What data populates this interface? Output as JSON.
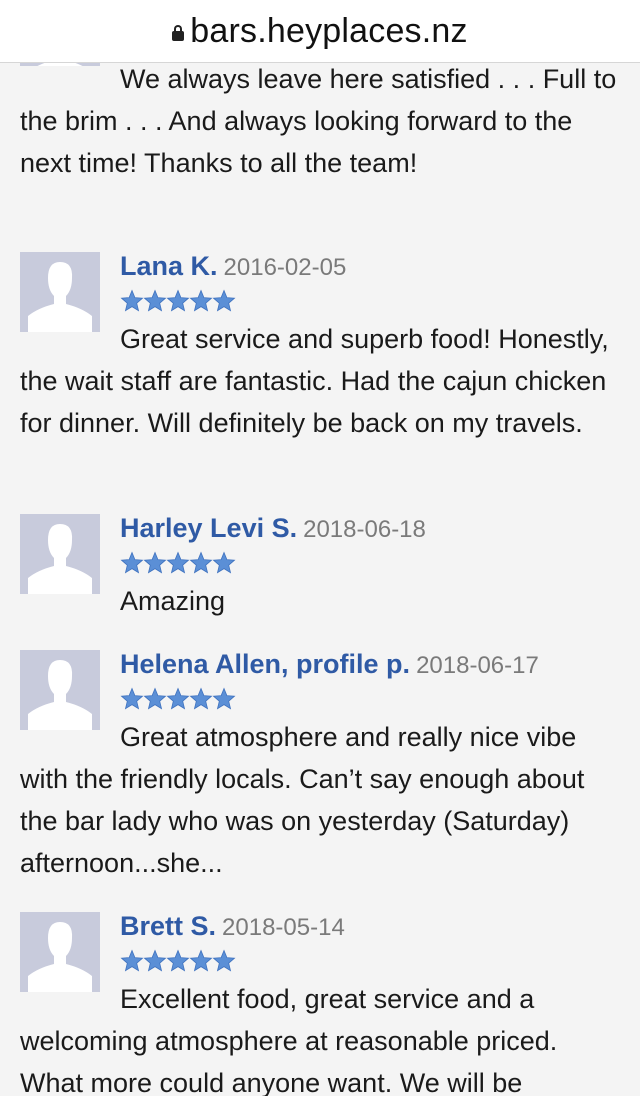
{
  "browser": {
    "url": "bars.heyplaces.nz"
  },
  "colors": {
    "name": "#2f5aa5",
    "date": "#7a7a7a",
    "star": "#5b8fd6",
    "avatar_bg": "#c8cbdc"
  },
  "partial_review": {
    "text": "We always leave here satisfied . . . Full to the brim . . . And always looking forward to the next time! Thanks to all the team!"
  },
  "reviews": [
    {
      "name": "Lana K.",
      "date": "2016-02-05",
      "rating": 5,
      "text": "Great service and superb food! Honestly, the wait staff are fantastic. Had the cajun chicken for dinner. Will definitely be back on my travels."
    },
    {
      "name": "Harley Levi S.",
      "date": "2018-06-18",
      "rating": 5,
      "text": "Amazing"
    },
    {
      "name": "Helena Allen, profile p.",
      "date": "2018-06-17",
      "rating": 5,
      "text": "Great atmosphere and really nice vibe with the friendly locals. Can’t say enough about the bar lady who was on yesterday (Saturday) afternoon...she..."
    },
    {
      "name": "Brett S.",
      "date": "2018-05-14",
      "rating": 5,
      "text": "Excellent food, great service and a welcoming atmosphere at reasonable priced. What more could anyone want. We will be"
    }
  ]
}
